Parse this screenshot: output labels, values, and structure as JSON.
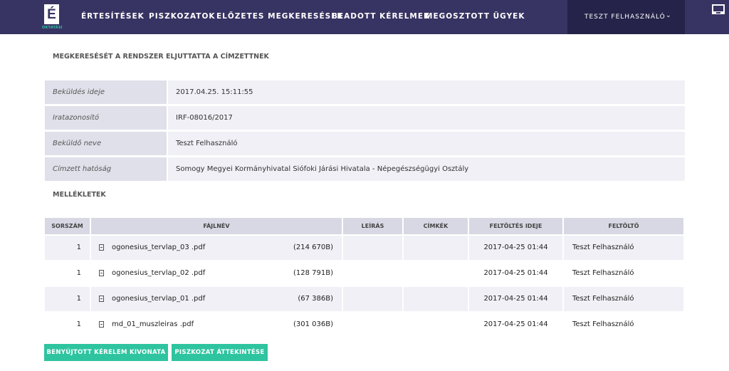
{
  "nav": {
    "logo_letter": "É",
    "logo_sub": "OKTATÁSI",
    "items": [
      {
        "label": "ÉRTESÍTÉSEK"
      },
      {
        "label": "PISZKOZATOK"
      },
      {
        "label": "ELŐZETES MEGKERESÉSEK"
      },
      {
        "label": "BEADOTT KÉRELMEK"
      },
      {
        "label": "MEGOSZTOTT ÜGYEK"
      }
    ],
    "user": "TESZT FELHASZNÁLÓ",
    "chevron": "⌄"
  },
  "status_title": "MEGKERESÉSÉT A RENDSZER ELJUTTATTA A CÍMZETTNEK",
  "info": [
    {
      "label": "Beküldés ideje",
      "value": "2017.04.25. 15:11:55"
    },
    {
      "label": "Iratazonosító",
      "value": "IRF-08016/2017"
    },
    {
      "label": "Beküldő neve",
      "value": "Teszt Felhasználó"
    },
    {
      "label": "Címzett hatóság",
      "value": "Somogy Megyei Kormányhivatal Siófoki Járási Hivatala - Népegészségügyi Osztály"
    }
  ],
  "attachments_title": "MELLÉKLETEK",
  "table": {
    "headers": [
      "SORSZÁM",
      "FÁJLNÉV",
      "LEÍRÁS",
      "CÍMKÉK",
      "FELTÖLTÉS IDEJE",
      "FELTÖLTŐ"
    ],
    "rows": [
      {
        "num": "1",
        "file": "ogonesius_tervlap_03 .pdf",
        "size": "(214 670B)",
        "desc": "",
        "tags": "",
        "time": "2017-04-25 01:44",
        "uploader": "Teszt Felhasználó"
      },
      {
        "num": "1",
        "file": "ogonesius_tervlap_02 .pdf",
        "size": "(128 791B)",
        "desc": "",
        "tags": "",
        "time": "2017-04-25 01:44",
        "uploader": "Teszt Felhasználó"
      },
      {
        "num": "1",
        "file": "ogonesius_tervlap_01 .pdf",
        "size": "(67 386B)",
        "desc": "",
        "tags": "",
        "time": "2017-04-25 01:44",
        "uploader": "Teszt Felhasználó"
      },
      {
        "num": "1",
        "file": "md_01_muszleiras .pdf",
        "size": "(301 036B)",
        "desc": "",
        "tags": "",
        "time": "2017-04-25 01:44",
        "uploader": "Teszt Felhasználó"
      }
    ]
  },
  "buttons": {
    "extract": "BENYÚJTOTT KÉRELEM KIVONATA",
    "draft": "PISZKOZAT ÁTTEKINTÉSE"
  },
  "colors": {
    "nav": "#373362",
    "accent": "#2ec4a0"
  }
}
